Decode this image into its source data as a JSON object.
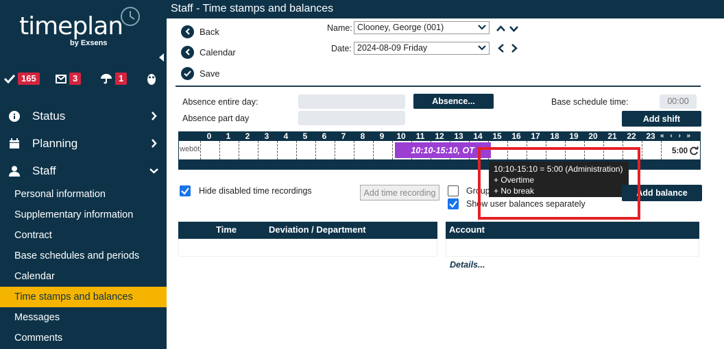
{
  "app": {
    "logo_text": "timeplan",
    "logo_byline": "by Exsens",
    "page_title": "Staff - Time stamps and balances"
  },
  "badges": {
    "approvals": "165",
    "messages": "3",
    "vacation": "1"
  },
  "nav": {
    "status": "Status",
    "planning": "Planning",
    "staff": "Staff",
    "staff_items": [
      "Personal information",
      "Supplementary information",
      "Contract",
      "Base schedules and periods",
      "Calendar",
      "Time stamps and balances",
      "Messages",
      "Comments"
    ]
  },
  "toolbar": {
    "back": "Back",
    "calendar": "Calendar",
    "save": "Save"
  },
  "form": {
    "name_label": "Name:",
    "name_value": "Clooney, George (001)",
    "date_label": "Date:",
    "date_value": "2024-08-09 Friday",
    "absence_entire_label": "Absence entire day:",
    "absence_part_label": "Absence part day",
    "absence_button": "Absence...",
    "base_schedule_label": "Base schedule time:",
    "base_schedule_value": "00:00",
    "add_shift_button": "Add shift"
  },
  "timeline": {
    "hours": [
      "0",
      "1",
      "2",
      "3",
      "4",
      "5",
      "6",
      "7",
      "8",
      "9",
      "10",
      "11",
      "12",
      "13",
      "14",
      "15",
      "16",
      "17",
      "18",
      "19",
      "20",
      "21",
      "22",
      "23"
    ],
    "row_label": "weböt",
    "shift_label": "10:10-15:10, OT",
    "shift_start_hour": 10.1667,
    "shift_end_hour": 15.1667,
    "total": "5:00",
    "nav_glyphs": "« ‹ › »"
  },
  "tooltip": {
    "line1": "10:10-15:10 = 5:00 (Administration)",
    "line2": "+ Overtime",
    "line3": "+ No break"
  },
  "options": {
    "hide_disabled": "Hide disabled time recordings",
    "add_time_recording": "Add time recording",
    "group": "Group",
    "show_user_balances": "Show user balances separately",
    "add_balance": "Add balance"
  },
  "tables": {
    "time_col": "Time",
    "deviation_col": "Deviation / Department",
    "account_col": "Account",
    "details_link": "Details..."
  }
}
